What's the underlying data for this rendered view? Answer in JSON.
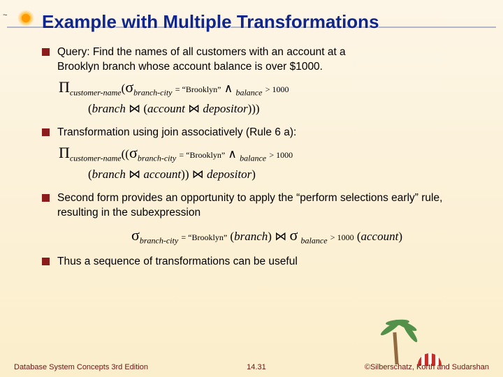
{
  "title": "Example with Multiple Transformations",
  "bullets": {
    "b1_line1": "Query:  Find the names of all customers with an account at a",
    "b1_line2": "Brooklyn branch whose account balance is over $1000.",
    "b2": "Transformation using join associatively (Rule 6 a):",
    "b3": "Second form provides an opportunity to apply the “perform selections early” rule, resulting in the subexpression",
    "b4": "Thus a sequence of transformations can be useful"
  },
  "sym": {
    "Pi": "Π",
    "sigma": "σ",
    "join": "⋈",
    "and": "∧"
  },
  "sub": {
    "customer_name": "customer-name",
    "branch_city": "branch-city",
    "balance": "balance"
  },
  "txt": {
    "eq_brooklyn": "= “Brooklyn”",
    "gt1000": "> 1000",
    "branch": "branch",
    "account": "account",
    "depositor": "depositor"
  },
  "footer": {
    "left": "Database System Concepts 3rd Edition",
    "center": "14.31",
    "right": "©Silberschatz, Korth and Sudarshan"
  }
}
